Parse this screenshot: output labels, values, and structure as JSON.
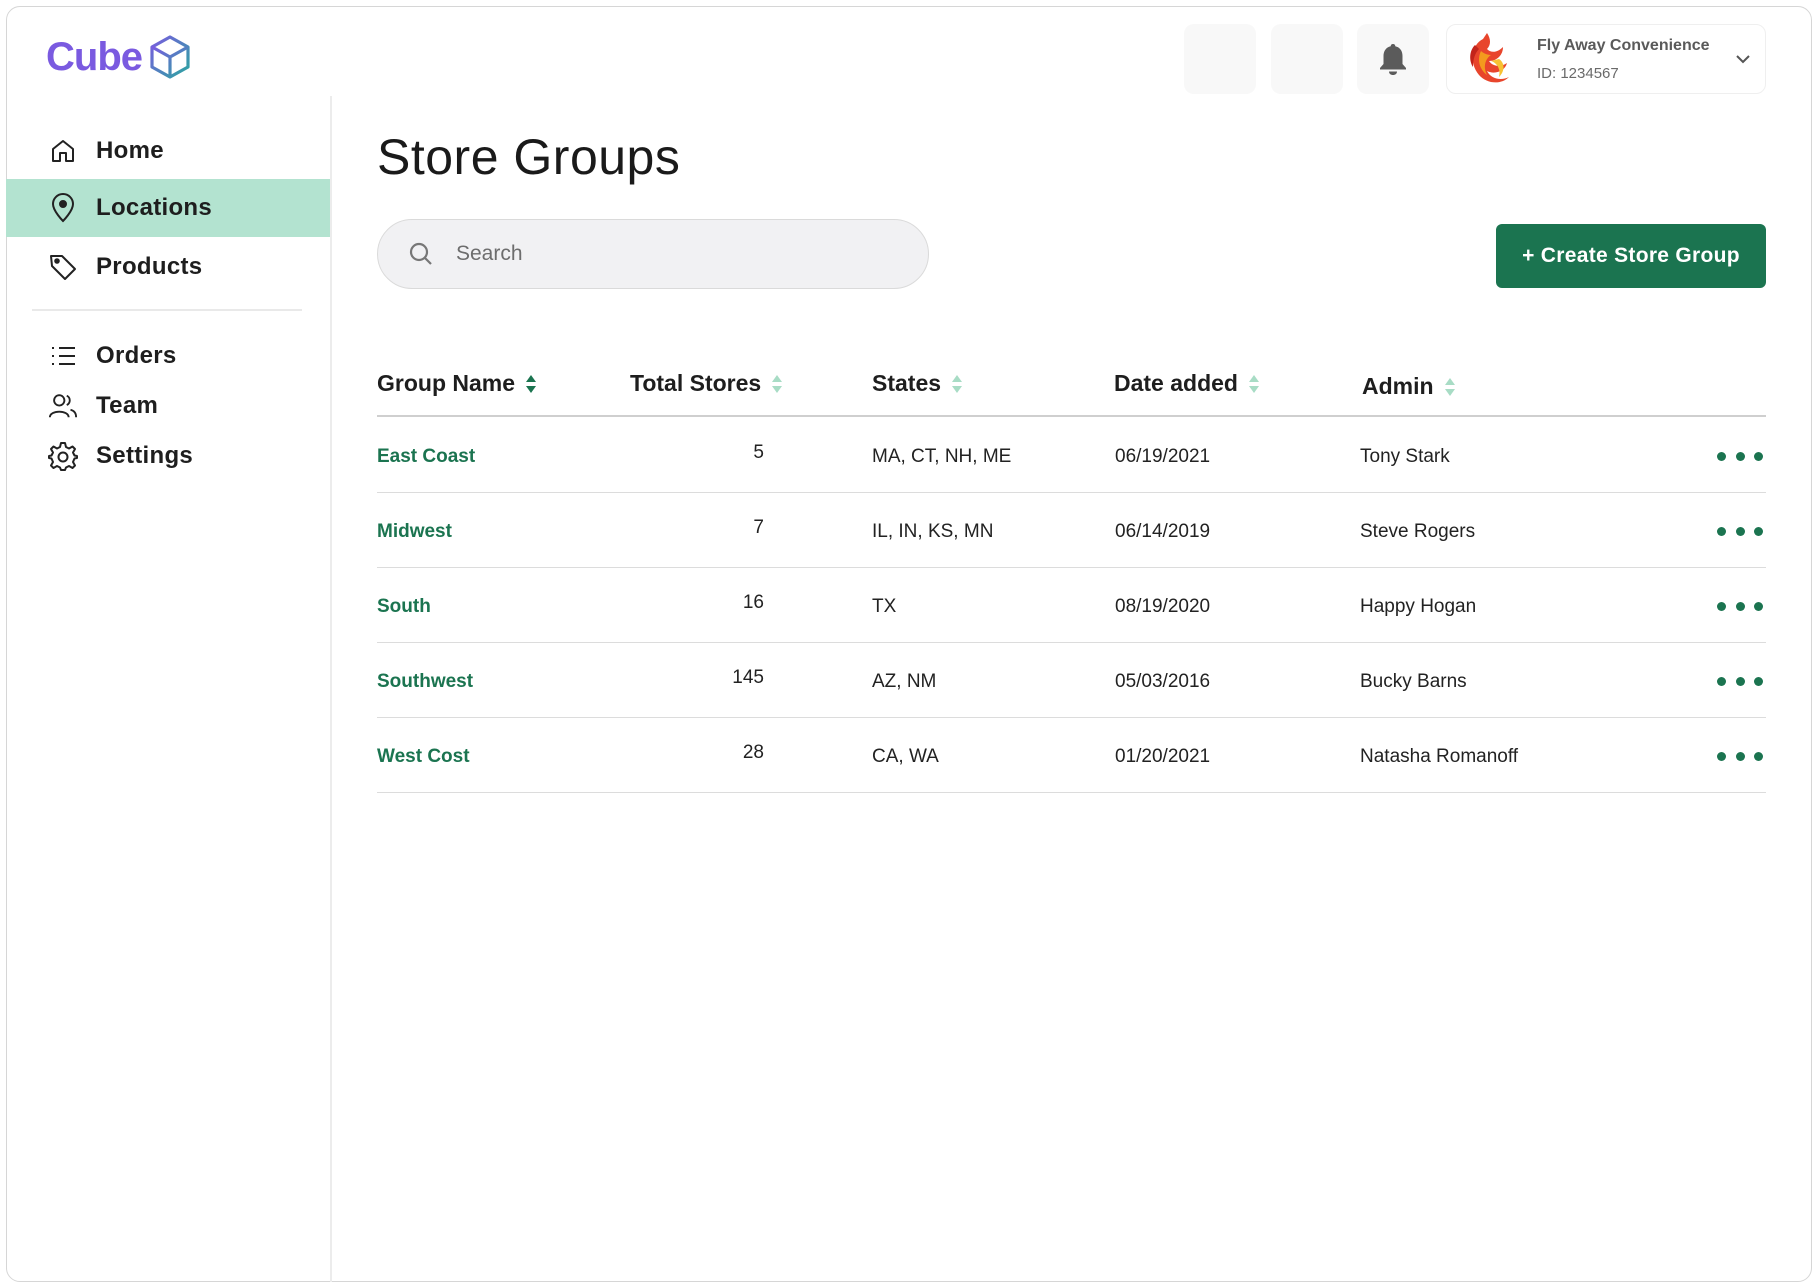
{
  "app": {
    "logo_text": "Cube"
  },
  "sidebar": {
    "primary": [
      {
        "label": "Home",
        "icon": "home-icon"
      },
      {
        "label": "Locations",
        "icon": "map-pin-icon",
        "active": true
      },
      {
        "label": "Products",
        "icon": "tag-icon"
      }
    ],
    "secondary": [
      {
        "label": "Orders",
        "icon": "list-icon"
      },
      {
        "label": "Team",
        "icon": "users-icon"
      },
      {
        "label": "Settings",
        "icon": "gear-icon"
      }
    ]
  },
  "topbar": {
    "account_name": "Fly Away Convenience",
    "account_id": "ID: 1234567"
  },
  "page": {
    "title": "Store Groups",
    "search_placeholder": "Search",
    "create_button": "+ Create Store Group"
  },
  "table": {
    "columns": [
      "Group Name",
      "Total Stores",
      "States",
      "Date added",
      "Admin"
    ],
    "rows": [
      {
        "group": "East Coast",
        "stores": "5",
        "states": "MA, CT, NH, ME",
        "date": "06/19/2021",
        "admin": "Tony Stark"
      },
      {
        "group": "Midwest",
        "stores": "7",
        "states": "IL, IN, KS, MN",
        "date": "06/14/2019",
        "admin": "Steve Rogers"
      },
      {
        "group": "South",
        "stores": "16",
        "states": "TX",
        "date": "08/19/2020",
        "admin": "Happy Hogan"
      },
      {
        "group": "Southwest",
        "stores": "145",
        "states": "AZ, NM",
        "date": "05/03/2016",
        "admin": "Bucky Barns"
      },
      {
        "group": "West Cost",
        "stores": "28",
        "states": "CA, WA",
        "date": "01/20/2021",
        "admin": "Natasha Romanoff"
      }
    ]
  },
  "colors": {
    "brand": "#7a5ae0",
    "accent": "#1b7450",
    "active_nav": "#b3e3d0",
    "sort_inactive": "#a8dcc5"
  }
}
